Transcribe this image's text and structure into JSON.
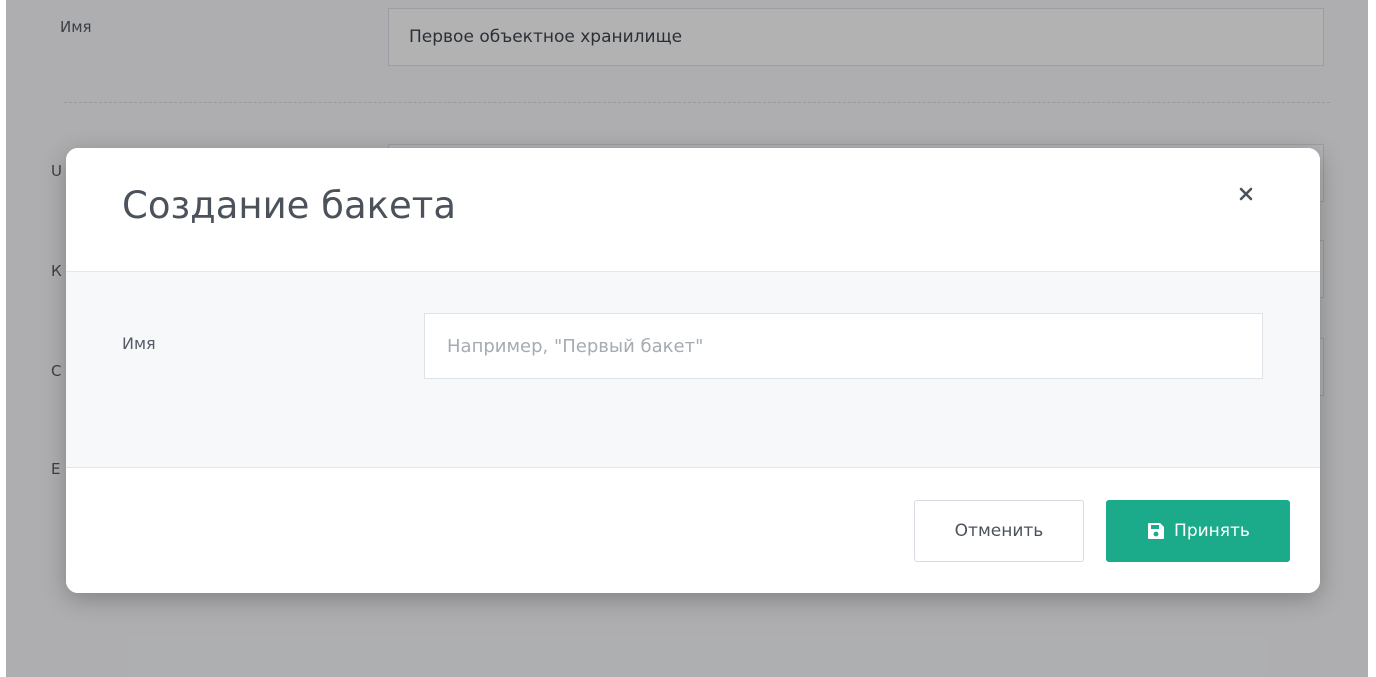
{
  "background": {
    "name_label": "Имя",
    "name_value": "Первое объектное хранилище",
    "partial_labels": [
      "U",
      "К",
      "С",
      "Е"
    ]
  },
  "modal": {
    "title": "Создание бакета",
    "close_icon": "close-icon",
    "name_label": "Имя",
    "name_placeholder": "Например, \"Первый бакет\"",
    "name_value": "",
    "cancel_label": "Отменить",
    "accept_label": "Принять",
    "accept_icon": "save-icon"
  },
  "colors": {
    "accent": "#1cab8a",
    "overlay": "rgba(0,0,0,0.3)"
  }
}
